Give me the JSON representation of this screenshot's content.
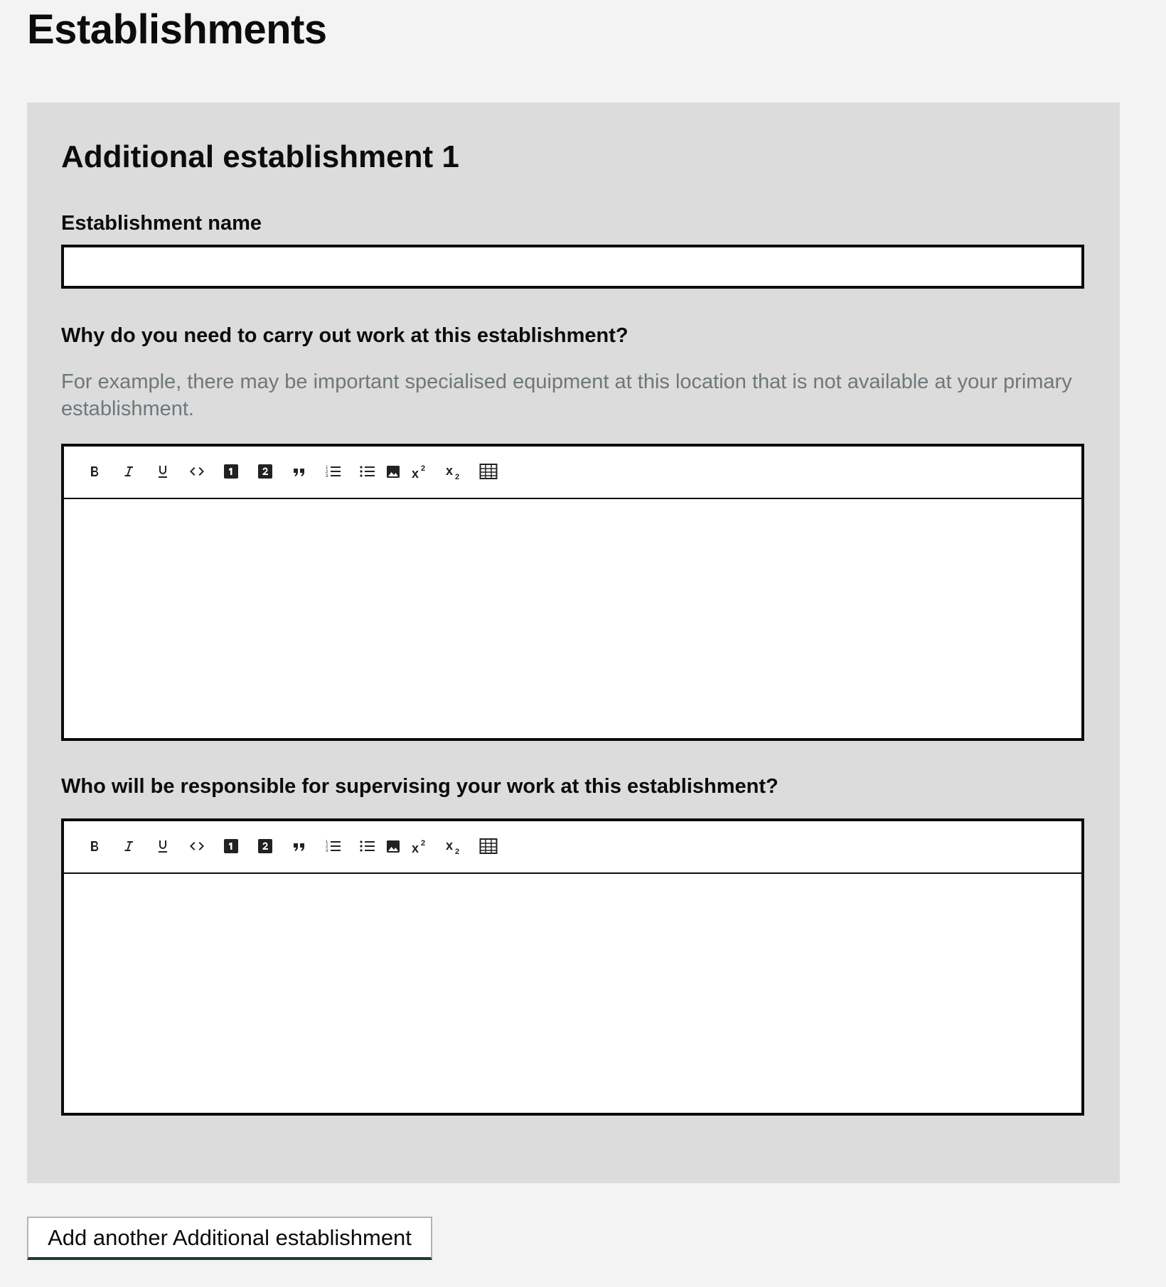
{
  "page": {
    "title": "Establishments"
  },
  "establishment": {
    "heading": "Additional establishment 1",
    "name_field": {
      "label": "Establishment name",
      "value": "",
      "placeholder": ""
    },
    "reason_field": {
      "label": "Why do you need to carry out work at this establishment?",
      "hint": "For example, there may be important specialised equipment at this location that is not available at your primary establishment.",
      "value": ""
    },
    "supervisor_field": {
      "label": "Who will be responsible for supervising your work at this establishment?",
      "value": ""
    }
  },
  "editor_toolbar": {
    "buttons": [
      {
        "icon": "bold-icon"
      },
      {
        "icon": "italic-icon"
      },
      {
        "icon": "underline-icon"
      },
      {
        "icon": "code-icon"
      },
      {
        "icon": "heading-1-icon"
      },
      {
        "icon": "heading-2-icon"
      },
      {
        "icon": "blockquote-icon"
      },
      {
        "icon": "ordered-list-icon"
      },
      {
        "icon": "bullet-list-icon"
      },
      {
        "icon": "image-icon"
      },
      {
        "icon": "superscript-icon"
      },
      {
        "icon": "subscript-icon"
      },
      {
        "icon": "table-icon"
      }
    ]
  },
  "actions": {
    "add_another_label": "Add another Additional establishment"
  },
  "colors": {
    "page_background": "#f3f3f3",
    "panel_background": "#dcdcdc",
    "border": "#0b0c0c",
    "hint_text": "#6f777b",
    "button_underline": "#1d3b26"
  }
}
